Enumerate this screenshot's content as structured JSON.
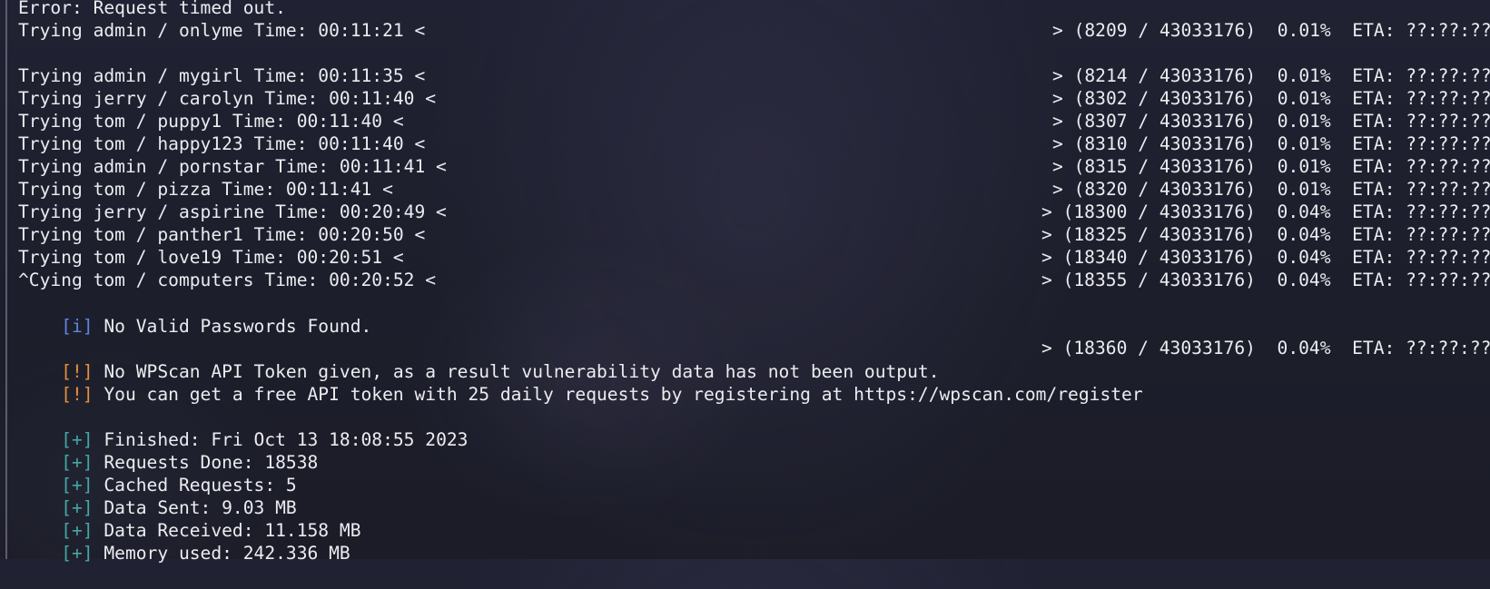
{
  "terminal": {
    "lines": [
      {
        "text": "Error: Request timed out.",
        "progress": ""
      },
      {
        "text": "Trying admin / onlyme Time: 00:11:21 <",
        "progress": "> (8209 / 43033176)  0.01%  ETA: ??:??:??"
      },
      {
        "text": "",
        "progress": ""
      },
      {
        "text": "Trying admin / mygirl Time: 00:11:35 <",
        "progress": "> (8214 / 43033176)  0.01%  ETA: ??:??:??"
      },
      {
        "text": "Trying jerry / carolyn Time: 00:11:40 <",
        "progress": "> (8302 / 43033176)  0.01%  ETA: ??:??:??"
      },
      {
        "text": "Trying tom / puppy1 Time: 00:11:40 <",
        "progress": "> (8307 / 43033176)  0.01%  ETA: ??:??:??"
      },
      {
        "text": "Trying tom / happy123 Time: 00:11:40 <",
        "progress": "> (8310 / 43033176)  0.01%  ETA: ??:??:??"
      },
      {
        "text": "Trying admin / pornstar Time: 00:11:41 <",
        "progress": "> (8315 / 43033176)  0.01%  ETA: ??:??:??"
      },
      {
        "text": "Trying tom / pizza Time: 00:11:41 <",
        "progress": "> (8320 / 43033176)  0.01%  ETA: ??:??:??"
      },
      {
        "text": "Trying jerry / aspirine Time: 00:20:49 <",
        "progress": "> (18300 / 43033176)  0.04%  ETA: ??:??:??"
      },
      {
        "text": "Trying tom / panther1 Time: 00:20:50 <",
        "progress": "> (18325 / 43033176)  0.04%  ETA: ??:??:??"
      },
      {
        "text": "Trying tom / love19 Time: 00:20:51 <",
        "progress": "> (18340 / 43033176)  0.04%  ETA: ??:??:??"
      },
      {
        "text": "^Cying tom / computers Time: 00:20:52 <",
        "progress": "> (18355 / 43033176)  0.04%  ETA: ??:??:??"
      }
    ],
    "info_line": {
      "tag": "[i]",
      "text": " No Valid Passwords Found."
    },
    "warn_lines": [
      {
        "tag": "[!]",
        "text": " No WPScan API Token given, as a result vulnerability data has not been output.",
        "progress": "> (18360 / 43033176)  0.04%  ETA: ??:??:??"
      },
      {
        "tag": "[!]",
        "text": " You can get a free API token with 25 daily requests by registering at https://wpscan.com/register",
        "progress": ""
      }
    ],
    "summary": [
      {
        "tag": "[+]",
        "text": " Finished: Fri Oct 13 18:08:55 2023"
      },
      {
        "tag": "[+]",
        "text": " Requests Done: 18538"
      },
      {
        "tag": "[+]",
        "text": " Cached Requests: 5"
      },
      {
        "tag": "[+]",
        "text": " Data Sent: 9.03 MB"
      },
      {
        "tag": "[+]",
        "text": " Data Received: 11.158 MB"
      },
      {
        "tag": "[+]",
        "text": " Memory used: 242.336 MB"
      }
    ]
  },
  "colors": {
    "background": "#1e2030",
    "text": "#ececf0",
    "info_tag": "#5d86e0",
    "warn_tag": "#e6913c",
    "ok_tag": "#42a8a4"
  }
}
